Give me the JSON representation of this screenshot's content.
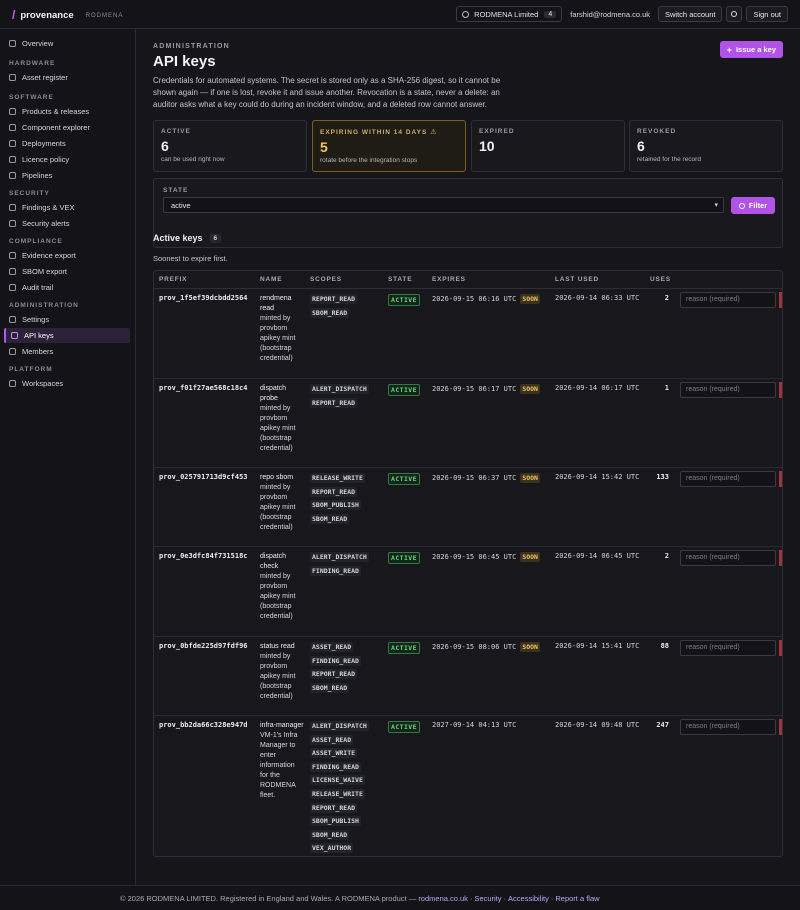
{
  "topbar": {
    "brand": "provenance",
    "org_code": "RODMENA",
    "org_name": "RODMENA Limited",
    "org_count": "4",
    "email": "farshid@rodmena.co.uk",
    "switch_account": "Switch account",
    "sign_out": "Sign out"
  },
  "sidebar": {
    "overview": "Overview",
    "groups": [
      {
        "title": "HARDWARE",
        "items": [
          "Asset register"
        ]
      },
      {
        "title": "SOFTWARE",
        "items": [
          "Products & releases",
          "Component explorer",
          "Deployments",
          "Licence policy",
          "Pipelines"
        ]
      },
      {
        "title": "SECURITY",
        "items": [
          "Findings & VEX",
          "Security alerts"
        ]
      },
      {
        "title": "COMPLIANCE",
        "items": [
          "Evidence export",
          "SBOM export",
          "Audit trail"
        ]
      },
      {
        "title": "ADMINISTRATION",
        "items": [
          "Settings",
          "API keys",
          "Members"
        ]
      },
      {
        "title": "PLATFORM",
        "items": [
          "Workspaces"
        ]
      }
    ],
    "active_item": "API keys"
  },
  "page": {
    "eyebrow": "ADMINISTRATION",
    "title": "API keys",
    "issue_button": "Issue a key",
    "intro": "Credentials for automated systems. The secret is stored only as a SHA-256 digest, so it cannot be shown again — if one is lost, revoke it and issue another. Revocation is a state, never a delete: an auditor asks what a key could do during an incident window, and a deleted row cannot answer."
  },
  "stats": {
    "active": {
      "label": "ACTIVE",
      "value": "6",
      "sub": "can be used right now"
    },
    "expiring": {
      "label": "EXPIRING WITHIN 14 DAYS",
      "value": "5",
      "sub": "rotate before the integration stops"
    },
    "expired": {
      "label": "EXPIRED",
      "value": "10",
      "sub": ""
    },
    "revoked": {
      "label": "REVOKED",
      "value": "6",
      "sub": "retained for the record"
    }
  },
  "filter": {
    "label": "STATE",
    "selected": "active",
    "button": "Filter"
  },
  "keys_section": {
    "title": "Active keys",
    "count": "6",
    "subtitle": "Soonest to expire first."
  },
  "table": {
    "headers": {
      "prefix": "PREFIX",
      "name": "NAME",
      "scopes": "SCOPES",
      "state": "STATE",
      "expires": "EXPIRES",
      "last_used": "LAST USED",
      "uses": "USES"
    },
    "reason_placeholder": "reason (required)",
    "soon_label": "SOON",
    "rows": [
      {
        "prefix": "prov_1f5ef39dcbdd2564",
        "name": "rendmena read",
        "desc": "minted by provbom apikey mint (bootstrap credential)",
        "scopes": [
          "REPORT_READ",
          "SBOM_READ"
        ],
        "state": "ACTIVE",
        "expires": "2026-09-15 06:16 UTC",
        "soon": true,
        "last_used": "2026-09-14 06:33 UTC",
        "uses": "2"
      },
      {
        "prefix": "prov_f01f27ae568c18c4",
        "name": "dispatch probe",
        "desc": "minted by provbom apikey mint (bootstrap credential)",
        "scopes": [
          "ALERT_DISPATCH",
          "REPORT_READ"
        ],
        "state": "ACTIVE",
        "expires": "2026-09-15 06:17 UTC",
        "soon": true,
        "last_used": "2026-09-14 06:17 UTC",
        "uses": "1"
      },
      {
        "prefix": "prov_025791713d9cf453",
        "name": "repo sbom",
        "desc": "minted by provbom apikey mint (bootstrap credential)",
        "scopes": [
          "RELEASE_WRITE",
          "REPORT_READ",
          "SBOM_PUBLISH",
          "SBOM_READ"
        ],
        "state": "ACTIVE",
        "expires": "2026-09-15 06:37 UTC",
        "soon": true,
        "last_used": "2026-09-14 15:42 UTC",
        "uses": "133"
      },
      {
        "prefix": "prov_0e3dfc84f731518c",
        "name": "dispatch check",
        "desc": "minted by provbom apikey mint (bootstrap credential)",
        "scopes": [
          "ALERT_DISPATCH",
          "FINDING_READ"
        ],
        "state": "ACTIVE",
        "expires": "2026-09-15 06:45 UTC",
        "soon": true,
        "last_used": "2026-09-14 06:45 UTC",
        "uses": "2"
      },
      {
        "prefix": "prov_0bfde225d97fdf96",
        "name": "status read",
        "desc": "minted by provbom apikey mint (bootstrap credential)",
        "scopes": [
          "ASSET_READ",
          "FINDING_READ",
          "REPORT_READ",
          "SBOM_READ"
        ],
        "state": "ACTIVE",
        "expires": "2026-09-15 08:06 UTC",
        "soon": true,
        "last_used": "2026-09-14 15:41 UTC",
        "uses": "88"
      },
      {
        "prefix": "prov_bb2da66c328e947d",
        "name": "infra-manager",
        "desc": "VM-1's Infra Manager to enter information for the RODMENA fleet.",
        "scopes": [
          "ALERT_DISPATCH",
          "ASSET_READ",
          "ASSET_WRITE",
          "FINDING_READ",
          "LICENSE_WAIVE",
          "RELEASE_WRITE",
          "REPORT_READ",
          "SBOM_PUBLISH",
          "SBOM_READ",
          "VEX_AUTHOR"
        ],
        "state": "ACTIVE",
        "expires": "2027-09-14 04:13 UTC",
        "soon": false,
        "last_used": "2026-09-14 09:48 UTC",
        "uses": "247"
      }
    ]
  },
  "footer": {
    "text": "© 2026 RODMENA LIMITED. Registered in England and Wales. A RODMENA product —",
    "link_site": "rodmena.co.uk",
    "link_security": "Security",
    "link_accessibility": "Accessibility",
    "link_report": "Report a flaw",
    "sep": "·"
  },
  "colors": {
    "accent": "#b153e6",
    "active_green": "#5fd67a",
    "warning_amber": "#f1c45a"
  }
}
